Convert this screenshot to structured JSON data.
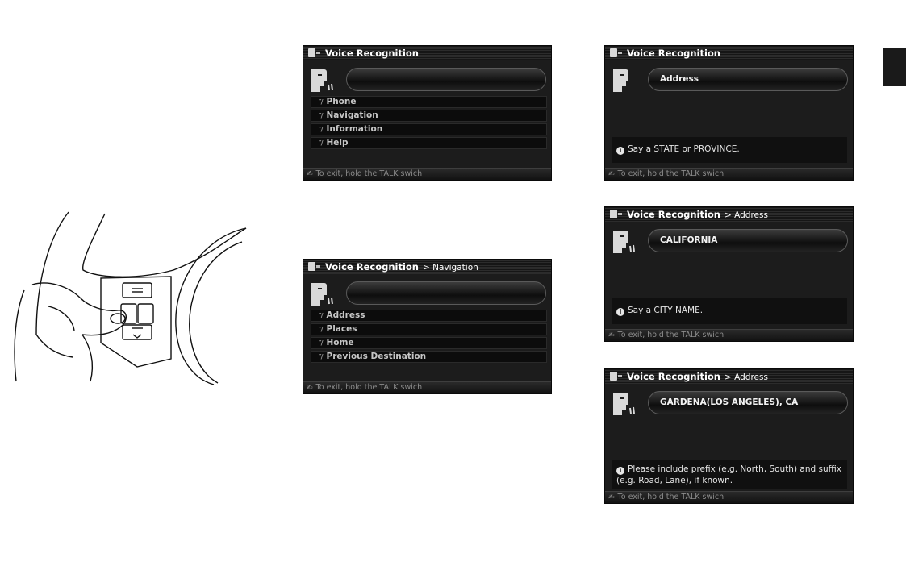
{
  "screens": [
    {
      "title": "Voice Recognition",
      "crumb": "",
      "field_value": "",
      "menu": [
        "Phone",
        "Navigation",
        "Information",
        "Help"
      ],
      "info": "",
      "footer": "To exit, hold the TALK swich"
    },
    {
      "title": "Voice Recognition",
      "crumb": "> Navigation",
      "field_value": "",
      "menu": [
        "Address",
        "Places",
        "Home",
        "Previous Destination"
      ],
      "info": "",
      "footer": "To exit, hold the TALK swich"
    },
    {
      "title": "Voice Recognition",
      "crumb": "",
      "field_value": "Address",
      "menu": [],
      "info": "Say a STATE or PROVINCE.",
      "footer": "To exit, hold the TALK swich"
    },
    {
      "title": "Voice Recognition",
      "crumb": "> Address",
      "field_value": "CALIFORNIA",
      "menu": [],
      "info": "Say a CITY NAME.",
      "footer": "To exit, hold the TALK swich"
    },
    {
      "title": "Voice Recognition",
      "crumb": "> Address",
      "field_value": "GARDENA(LOS ANGELES), CA",
      "menu": [],
      "info": "Please include prefix (e.g. North, South) and suffix (e.g. Road, Lane), if known.",
      "footer": "To exit, hold the TALK swich"
    }
  ],
  "icons": {
    "info": "info-circle-icon",
    "talk": "talk-switch-icon",
    "voice": "speaking-head-icon",
    "mic": "microphone-waves-icon"
  },
  "colors": {
    "screen_bg": "#1c1c1c",
    "text": "#ffffff",
    "menu_text": "#c6c6c6",
    "chapter_tab": "#1a1a1a"
  }
}
